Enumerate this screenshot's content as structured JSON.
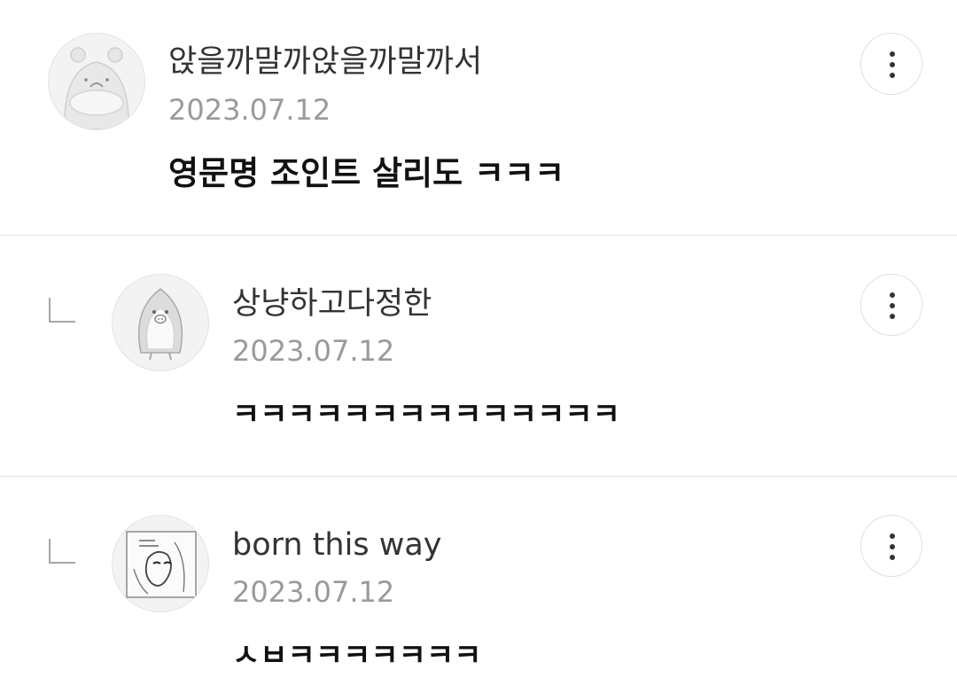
{
  "comments": [
    {
      "nickname": "앉을까말까앉을까말까서",
      "date": "2023.07.12",
      "content": "영문명 조인트 살리도 ㅋㅋㅋ",
      "avatar_icon": "hamster-avatar-icon",
      "is_reply": false
    },
    {
      "nickname": "상냥하고다정한",
      "date": "2023.07.12",
      "content": "ㅋㅋㅋㅋㅋㅋㅋㅋㅋㅋㅋㅋㅋㅋ",
      "avatar_icon": "penguin-avatar-icon",
      "is_reply": true
    },
    {
      "nickname": "born this way",
      "date": "2023.07.12",
      "content": "ㅅㅂㅋㅋㅋㅋㅋㅋㅋ",
      "avatar_icon": "album-cover-avatar-icon",
      "is_reply": true
    }
  ],
  "icons": {
    "more": "more-vertical-icon",
    "reply": "reply-arrow-icon"
  },
  "colors": {
    "nickname": "#333333",
    "date": "#9a9a9a",
    "content": "#111111",
    "divider": "#e3e3e3"
  }
}
